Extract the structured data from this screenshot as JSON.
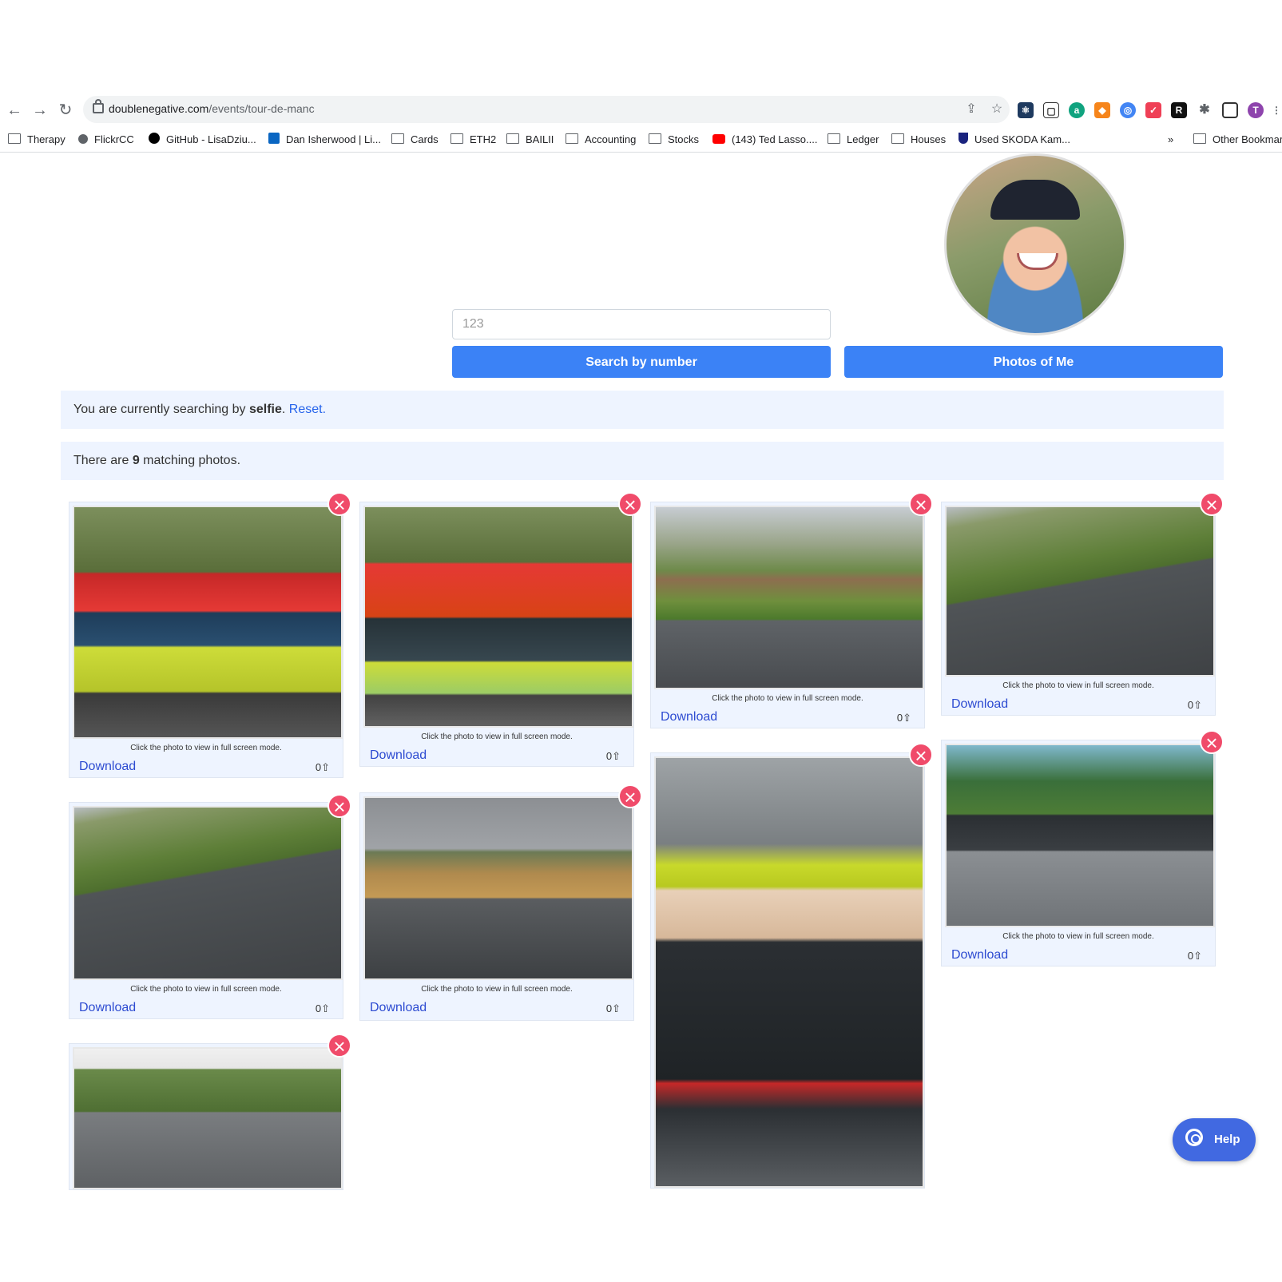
{
  "browser": {
    "url_host": "doublenegative.com",
    "url_path": "/events/tour-de-manc",
    "bookmarks": [
      "Therapy",
      "FlickrCC",
      "GitHub - LisaDziu...",
      "Dan Isherwood | Li...",
      "Cards",
      "ETH2",
      "BAILII",
      "Accounting",
      "Stocks",
      "(143) Ted Lasso....",
      "Ledger",
      "Houses",
      "Used SKODA Kam...",
      "»",
      "Other Bookmarks"
    ],
    "profile_initial": "T"
  },
  "search": {
    "placeholder": "123",
    "search_button": "Search by number",
    "selfie_button": "Photos of Me"
  },
  "status": {
    "prefix": "You are currently searching by ",
    "mode": "selfie",
    "sep": ". ",
    "reset": "Reset.",
    "count_prefix": "There are ",
    "count": "9",
    "count_suffix": " matching photos."
  },
  "card_text": {
    "caption": "Click the photo to view in full screen mode.",
    "download": "Download",
    "votes": "0⇧",
    "close": "×"
  },
  "help": {
    "label": "Help"
  },
  "colors": {
    "accent": "#3b82f6",
    "notice_bg": "#eef4ff",
    "remove": "#f04b6a",
    "link": "#2d4bd1"
  }
}
